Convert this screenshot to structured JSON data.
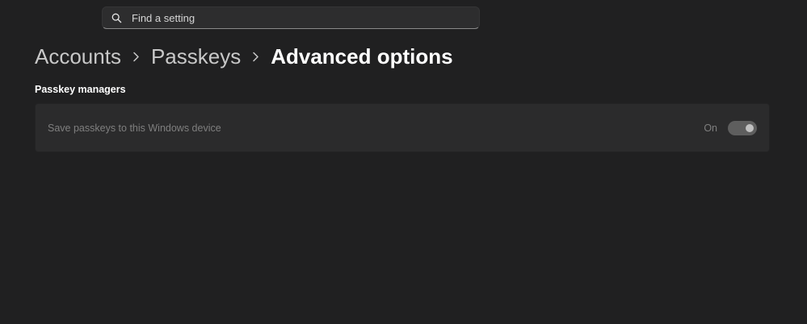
{
  "search": {
    "placeholder": "Find a setting",
    "icon": "search-icon"
  },
  "breadcrumb": {
    "items": [
      "Accounts",
      "Passkeys"
    ],
    "current": "Advanced options",
    "separator_icon": "chevron-right-icon"
  },
  "section": {
    "title": "Passkey managers"
  },
  "setting": {
    "label": "Save passkeys to this Windows device",
    "state_label": "On",
    "enabled": false,
    "checked": true
  },
  "colors": {
    "background": "#202021",
    "card": "#2b2b2c",
    "disabled_text": "#7f7f7f"
  }
}
